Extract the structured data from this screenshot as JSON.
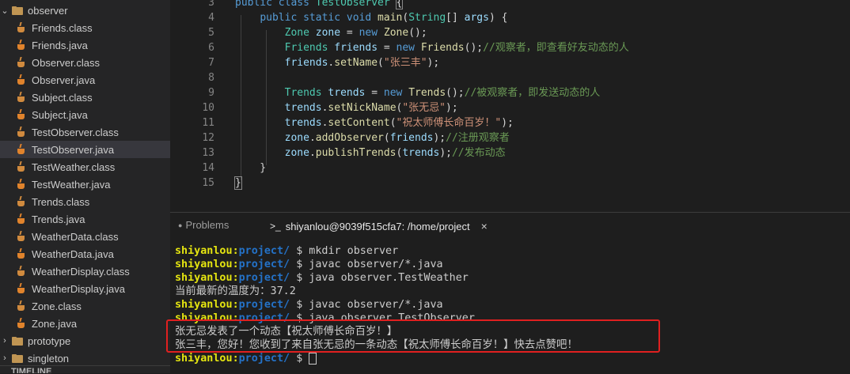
{
  "explorer": {
    "folder": "observer",
    "files": [
      {
        "name": "Friends.class",
        "kind": "class"
      },
      {
        "name": "Friends.java",
        "kind": "java"
      },
      {
        "name": "Observer.class",
        "kind": "class"
      },
      {
        "name": "Observer.java",
        "kind": "java"
      },
      {
        "name": "Subject.class",
        "kind": "class"
      },
      {
        "name": "Subject.java",
        "kind": "java"
      },
      {
        "name": "TestObserver.class",
        "kind": "class"
      },
      {
        "name": "TestObserver.java",
        "kind": "java",
        "selected": true
      },
      {
        "name": "TestWeather.class",
        "kind": "class"
      },
      {
        "name": "TestWeather.java",
        "kind": "java"
      },
      {
        "name": "Trends.class",
        "kind": "class"
      },
      {
        "name": "Trends.java",
        "kind": "java"
      },
      {
        "name": "WeatherData.class",
        "kind": "class"
      },
      {
        "name": "WeatherData.java",
        "kind": "java"
      },
      {
        "name": "WeatherDisplay.class",
        "kind": "class"
      },
      {
        "name": "WeatherDisplay.java",
        "kind": "java"
      },
      {
        "name": "Zone.class",
        "kind": "class"
      },
      {
        "name": "Zone.java",
        "kind": "java"
      }
    ],
    "folders_after": [
      "prototype",
      "singleton"
    ],
    "timeline_label": "TIMELINE"
  },
  "editor": {
    "lines": [
      {
        "n": "3",
        "tokens": [
          [
            "kw",
            "public "
          ],
          [
            "kw",
            "class "
          ],
          [
            "ty",
            "TestObserver "
          ],
          [
            "pl",
            "{"
          ]
        ]
      },
      {
        "n": "4",
        "tokens": [
          [
            "pl",
            "    "
          ],
          [
            "kw",
            "public "
          ],
          [
            "kw",
            "static "
          ],
          [
            "kw",
            "void "
          ],
          [
            "fn",
            "main"
          ],
          [
            "pl",
            "("
          ],
          [
            "ty",
            "String"
          ],
          [
            "pl",
            "[] "
          ],
          [
            "vr",
            "args"
          ],
          [
            "pl",
            ") {"
          ]
        ]
      },
      {
        "n": "5",
        "tokens": [
          [
            "pl",
            "        "
          ],
          [
            "ty",
            "Zone "
          ],
          [
            "vr",
            "zone"
          ],
          [
            "pl",
            " = "
          ],
          [
            "kw",
            "new "
          ],
          [
            "fn",
            "Zone"
          ],
          [
            "pl",
            "();"
          ]
        ]
      },
      {
        "n": "6",
        "tokens": [
          [
            "pl",
            "        "
          ],
          [
            "ty",
            "Friends "
          ],
          [
            "vr",
            "friends"
          ],
          [
            "pl",
            " = "
          ],
          [
            "kw",
            "new "
          ],
          [
            "fn",
            "Friends"
          ],
          [
            "pl",
            "();"
          ],
          [
            "cm",
            "//观察者，即查看好友动态的人"
          ]
        ]
      },
      {
        "n": "7",
        "tokens": [
          [
            "pl",
            "        "
          ],
          [
            "vr",
            "friends"
          ],
          [
            "pl",
            "."
          ],
          [
            "fn",
            "setName"
          ],
          [
            "pl",
            "("
          ],
          [
            "st",
            "\"张三丰\""
          ],
          [
            "pl",
            ");"
          ]
        ]
      },
      {
        "n": "8",
        "tokens": []
      },
      {
        "n": "9",
        "tokens": [
          [
            "pl",
            "        "
          ],
          [
            "ty",
            "Trends "
          ],
          [
            "vr",
            "trends"
          ],
          [
            "pl",
            " = "
          ],
          [
            "kw",
            "new "
          ],
          [
            "fn",
            "Trends"
          ],
          [
            "pl",
            "();"
          ],
          [
            "cm",
            "//被观察者，即发送动态的人"
          ]
        ]
      },
      {
        "n": "10",
        "tokens": [
          [
            "pl",
            "        "
          ],
          [
            "vr",
            "trends"
          ],
          [
            "pl",
            "."
          ],
          [
            "fn",
            "setNickName"
          ],
          [
            "pl",
            "("
          ],
          [
            "st",
            "\"张无忌\""
          ],
          [
            "pl",
            ");"
          ]
        ]
      },
      {
        "n": "11",
        "tokens": [
          [
            "pl",
            "        "
          ],
          [
            "vr",
            "trends"
          ],
          [
            "pl",
            "."
          ],
          [
            "fn",
            "setContent"
          ],
          [
            "pl",
            "("
          ],
          [
            "st",
            "\"祝太师傅长命百岁！\""
          ],
          [
            "pl",
            ");"
          ]
        ]
      },
      {
        "n": "12",
        "tokens": [
          [
            "pl",
            "        "
          ],
          [
            "vr",
            "zone"
          ],
          [
            "pl",
            "."
          ],
          [
            "fn",
            "addObserver"
          ],
          [
            "pl",
            "("
          ],
          [
            "vr",
            "friends"
          ],
          [
            "pl",
            ");"
          ],
          [
            "cm",
            "//注册观察者"
          ]
        ]
      },
      {
        "n": "13",
        "tokens": [
          [
            "pl",
            "        "
          ],
          [
            "vr",
            "zone"
          ],
          [
            "pl",
            "."
          ],
          [
            "fn",
            "publishTrends"
          ],
          [
            "pl",
            "("
          ],
          [
            "vr",
            "trends"
          ],
          [
            "pl",
            ");"
          ],
          [
            "cm",
            "//发布动态"
          ]
        ]
      },
      {
        "n": "14",
        "tokens": [
          [
            "pl",
            "    }"
          ]
        ]
      },
      {
        "n": "15",
        "tokens": [
          [
            "pl",
            "}"
          ]
        ]
      }
    ]
  },
  "panel": {
    "problems_tab": "Problems",
    "terminal_tab": "shiyanlou@9039f515cfa7: /home/project",
    "terminal_icon": ">_",
    "close_icon": "×",
    "terminal_lines": [
      {
        "type": "prompt",
        "user": "shiyanlou",
        "path": "project/",
        "cmd": "$ mkdir observer"
      },
      {
        "type": "prompt",
        "user": "shiyanlou",
        "path": "project/",
        "cmd": "$ javac observer/*.java"
      },
      {
        "type": "prompt",
        "user": "shiyanlou",
        "path": "project/",
        "cmd": "$ java observer.TestWeather"
      },
      {
        "type": "output",
        "text": "当前最新的温度为：37.2"
      },
      {
        "type": "prompt",
        "user": "shiyanlou",
        "path": "project/",
        "cmd": "$ javac observer/*.java"
      },
      {
        "type": "prompt",
        "user": "shiyanlou",
        "path": "project/",
        "cmd": "$ java observer.TestObserver"
      },
      {
        "type": "output",
        "text": "张无忌发表了一个动态【祝太师傅长命百岁！】"
      },
      {
        "type": "output",
        "text": "张三丰，您好！您收到了来自张无忌的一条动态【祝太师傅长命百岁！】快去点赞吧！"
      },
      {
        "type": "prompt",
        "user": "shiyanlou",
        "path": "project/",
        "cmd": "$ ",
        "cursor": true
      }
    ]
  },
  "colors": {
    "highlight_box": "#e02020",
    "prompt_user": "#e5e510",
    "prompt_path": "#2472c8"
  }
}
